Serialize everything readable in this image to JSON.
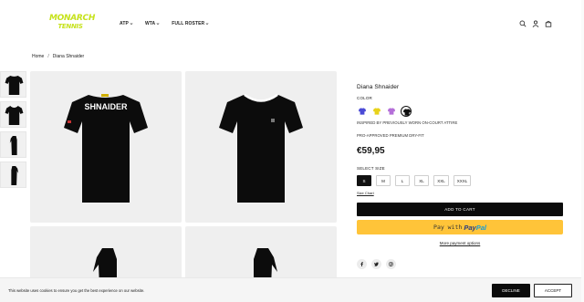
{
  "brand": {
    "line1": "MONARCH",
    "line2": "TENNIS",
    "color": "#c6e21b"
  },
  "nav": [
    {
      "label": "ATP"
    },
    {
      "label": "WTA"
    },
    {
      "label": "FULL ROSTER"
    }
  ],
  "header_icons": [
    "search-icon",
    "account-icon",
    "cart-icon"
  ],
  "breadcrumb": {
    "home": "Home",
    "separator": "/",
    "current": "Diana Shnaider"
  },
  "product": {
    "title": "Diana Shnaider",
    "color_label": "COLOR",
    "colors": [
      {
        "name": "purple",
        "hex": "#4b4bd6"
      },
      {
        "name": "yellow",
        "hex": "#e8d21a"
      },
      {
        "name": "lilac",
        "hex": "#b46fd8"
      },
      {
        "name": "black",
        "hex": "#111111",
        "selected": true
      }
    ],
    "desc1": "INSPIRED BY PREVIOUSLY WORN ON-COURT ATTIRE",
    "desc2": "PRO-APPROVED PREMIUM DRY-FIT",
    "price": "€59,95",
    "size_label": "SELECT SIZE",
    "sizes": [
      "S",
      "M",
      "L",
      "XL",
      "XXL",
      "XXXL"
    ],
    "selected_size": "S",
    "size_chart": "Size Chart",
    "add_to_cart": "ADD TO CART",
    "paypal_prefix": "Pay with",
    "paypal_logo_a": "Pay",
    "paypal_logo_b": "Pal",
    "more_payment": "More payment options",
    "shirt_print": "SHNAIDER",
    "social": [
      "facebook-icon",
      "twitter-icon",
      "pinterest-icon"
    ]
  },
  "cookie": {
    "text": "This website uses cookies to ensure you get the best experience on our website.",
    "decline": "DECLINE",
    "accept": "ACCEPT"
  }
}
